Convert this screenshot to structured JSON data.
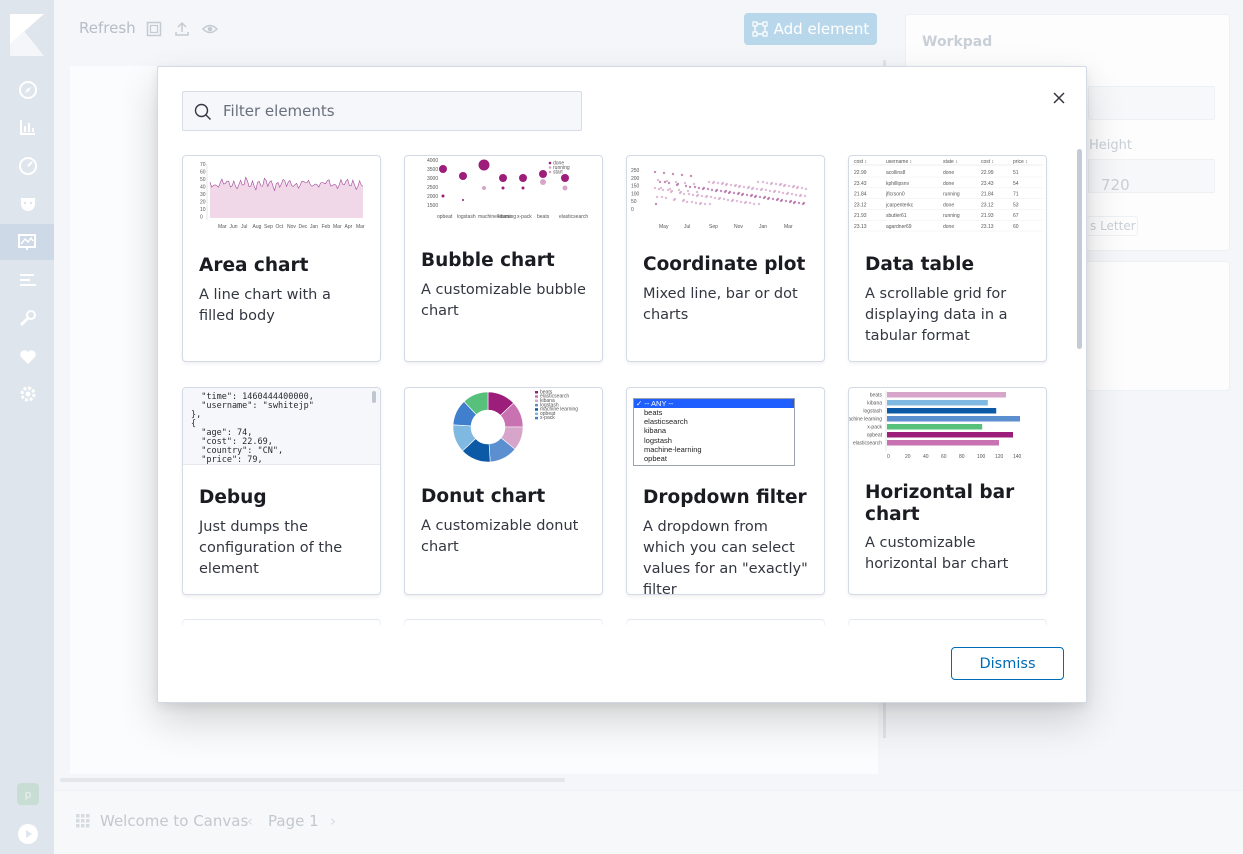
{
  "toolbar": {
    "refresh_label": "Refresh",
    "add_element_label": "Add element"
  },
  "workpad_panel": {
    "title": "Workpad",
    "height_label": "Height",
    "height_value": "720",
    "preset_label": "s Letter"
  },
  "footer": {
    "workpad_name": "Welcome to Canvas",
    "page_label": "Page 1"
  },
  "user": {
    "avatar_initial": "p"
  },
  "modal": {
    "search": {
      "placeholder": "Filter elements",
      "value": ""
    },
    "dismiss_label": "Dismiss",
    "elements": [
      {
        "title": "Area chart",
        "description": "A line chart with a filled body",
        "thumbnail": "area-chart"
      },
      {
        "title": "Bubble chart",
        "description": "A customizable bubble chart",
        "thumbnail": "bubble-chart"
      },
      {
        "title": "Coordinate plot",
        "description": "Mixed line, bar or dot charts",
        "thumbnail": "coordinate-plot"
      },
      {
        "title": "Data table",
        "description": "A scrollable grid for displaying data in a tabular format",
        "thumbnail": "data-table"
      },
      {
        "title": "Debug",
        "description": "Just dumps the configuration of the element",
        "thumbnail": "debug"
      },
      {
        "title": "Donut chart",
        "description": "A customizable donut chart",
        "thumbnail": "donut-chart"
      },
      {
        "title": "Dropdown filter",
        "description": "A dropdown from which you can select values for an \"exactly\" filter",
        "thumbnail": "dropdown-filter"
      },
      {
        "title": "Horizontal bar chart",
        "description": "A customizable horizontal bar chart",
        "thumbnail": "horizontal-bar-chart"
      }
    ]
  },
  "thumbnails": {
    "area_x_labels": [
      "Mar",
      "Jun",
      "Jul",
      "Aug",
      "Sep",
      "Oct",
      "Nov",
      "Dec",
      "Jan",
      "Feb",
      "Mar",
      "Apr",
      "Mar"
    ],
    "bubble_legend": [
      "done",
      "running",
      "start"
    ],
    "bubble_x_labels": [
      "opbeat",
      "logstash",
      "machine learning",
      "kibana",
      "x-pack",
      "beats",
      "elasticsearch"
    ],
    "coord_y_labels": [
      "250",
      "200",
      "150",
      "100",
      "50",
      "0"
    ],
    "coord_x_labels": [
      "May",
      "Jul",
      "Sep",
      "Nov",
      "Jan",
      "Mar"
    ],
    "table_headers": [
      "cost ↕",
      "username ↕",
      "state ↕",
      "cost ↕",
      "price ↕"
    ],
    "table_rows": [
      [
        "22.99",
        "acollins8",
        "done",
        "22.99",
        "51"
      ],
      [
        "23.43",
        "kphillipsnv",
        "done",
        "23.43",
        "54"
      ],
      [
        "21.84",
        "jflcrson0",
        "running",
        "21.84",
        "71"
      ],
      [
        "23.12",
        "jcarpenterkc",
        "done",
        "23.12",
        "53"
      ],
      [
        "21.93",
        "sbutler61",
        "running",
        "21.93",
        "67"
      ],
      [
        "23.13",
        "agardner69",
        "done",
        "23.13",
        "60"
      ]
    ],
    "debug_lines": [
      "  \"time\": 1460444400000,",
      "  \"username\": \"swhitejp\"",
      "},",
      "{",
      "  \"age\": 74,",
      "  \"cost\": 22.69,",
      "  \"country\": \"CN\",",
      "  \"price\": 79,"
    ],
    "dropdown_selected": "✓ -- ANY --",
    "dropdown_options": [
      "beats",
      "elasticsearch",
      "kibana",
      "logstash",
      "machine-learning",
      "opbeat"
    ],
    "donut_legend": [
      "beats",
      "elasticsearch",
      "kibana",
      "logstash",
      "machine learning",
      "opbeat",
      "x-pack"
    ],
    "hbar_labels": [
      "beats",
      "kibana",
      "logstash",
      "machine learning",
      "x-pack",
      "opbeat",
      "elasticsearch"
    ],
    "hbar_values": [
      0.85,
      0.72,
      0.78,
      0.95,
      0.68,
      0.9,
      0.8
    ],
    "hbar_colors": [
      "#d6a5c9",
      "#7fb8e0",
      "#0c5aa6",
      "#5b8fd0",
      "#57c17b",
      "#9c1d7a",
      "#c972b1"
    ]
  },
  "colors": {
    "accent_blue": "#006bb4",
    "nav_bg": "#dfe5ec",
    "area_fill": "#f0d8e8",
    "area_line": "#a3489a",
    "bubble_color": "#9c1d7a"
  }
}
